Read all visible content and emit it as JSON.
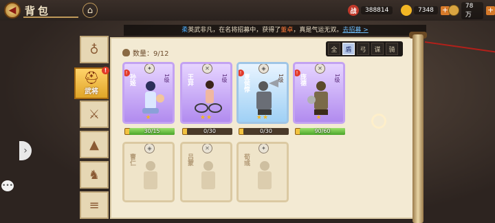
{
  "header": {
    "title": "背包",
    "back_icon": "back-arrow-icon",
    "home_icon": "home-icon"
  },
  "resources": [
    {
      "icon": "battle-power-icon",
      "glyph": "战",
      "value": "388814",
      "color": "#c0392b"
    },
    {
      "icon": "gold-ingot-icon",
      "glyph": "",
      "value": "7348",
      "color": "#f2b624"
    },
    {
      "icon": "coin-icon",
      "glyph": "",
      "value": "78万",
      "color": "#d9a441"
    }
  ],
  "ticker": {
    "prefix": "柔",
    "text1": "英武非凡，在名将招募中，获得了",
    "highlight": "董卓",
    "text2": "，真是气运无双。",
    "link": "去招募 >"
  },
  "sidebar": {
    "items": [
      {
        "name": "bag-tab",
        "icon": "pouch-icon",
        "glyph": "♁"
      },
      {
        "name": "general-tab",
        "label": "武将",
        "icon": "helmet-icon",
        "glyph": "⛑",
        "badge": "!"
      },
      {
        "name": "weapon-tab",
        "icon": "sword-icon",
        "glyph": "⚔"
      },
      {
        "name": "armor-tab",
        "icon": "armor-icon",
        "glyph": "▲"
      },
      {
        "name": "mount-tab",
        "icon": "horse-icon",
        "glyph": "♞"
      },
      {
        "name": "misc-tab",
        "icon": "scroll-icon",
        "glyph": "≡"
      }
    ]
  },
  "inventory": {
    "count_label": "数量：9/12"
  },
  "filters": [
    {
      "label": "全",
      "icon": "all-filter-icon"
    },
    {
      "label": "盾",
      "icon": "shield-filter-icon",
      "selected": true
    },
    {
      "label": "弓",
      "icon": "bow-filter-icon"
    },
    {
      "label": "谋",
      "icon": "strategist-filter-icon"
    },
    {
      "label": "骑",
      "icon": "cavalry-filter-icon"
    }
  ],
  "cards": [
    {
      "name": "孙姬",
      "level": "1级",
      "type_icon": "staff-icon",
      "type_glyph": "✦",
      "stars": "★",
      "progress": "30/15",
      "fill": 1.0,
      "rarity": "purple",
      "badge": "!"
    },
    {
      "name": "王异",
      "level": "1级",
      "type_icon": "sword-icon",
      "type_glyph": "✕",
      "stars": "★★",
      "progress": "0/30",
      "fill": 0.0,
      "rarity": "purple"
    },
    {
      "name": "夏侯惇",
      "level": "1级",
      "type_icon": "shield-icon",
      "type_glyph": "◈",
      "stars": "★★",
      "progress": "0/30",
      "fill": 0.0,
      "rarity": "blue",
      "badge": "!"
    },
    {
      "name": "庞德",
      "level": "1级",
      "type_icon": "sword-icon",
      "type_glyph": "✕",
      "stars": "★",
      "progress": "90/60",
      "fill": 1.0,
      "rarity": "purple",
      "badge": "!"
    },
    {
      "name": "曹仁",
      "level": "",
      "type_icon": "shield-icon",
      "type_glyph": "◈",
      "stars": "",
      "progress": "",
      "rarity": "ghost"
    },
    {
      "name": "吕蒙",
      "level": "",
      "type_icon": "sword-icon",
      "type_glyph": "✕",
      "stars": "",
      "progress": "",
      "rarity": "ghost"
    },
    {
      "name": "荀彧",
      "level": "",
      "type_icon": "staff-icon",
      "type_glyph": "✦",
      "stars": "",
      "progress": "",
      "rarity": "ghost"
    }
  ]
}
